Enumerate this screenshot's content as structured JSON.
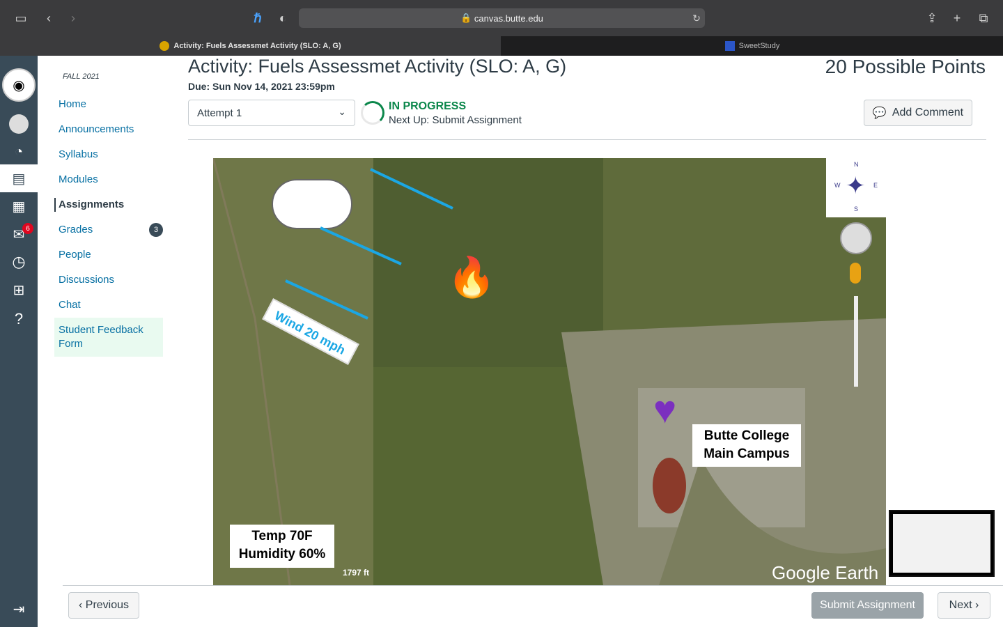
{
  "browser": {
    "url": "canvas.butte.edu",
    "tab_active": "Activity: Fuels Assessmet Activity (SLO: A, G)",
    "tab_other": "SweetStudy"
  },
  "course_nav": {
    "term": "FALL 2021",
    "items": [
      "Home",
      "Announcements",
      "Syllabus",
      "Modules",
      "Assignments",
      "Grades",
      "People",
      "Discussions",
      "Chat",
      "Student Feedback Form"
    ],
    "grades_badge": "3"
  },
  "global_nav": {
    "inbox_badge": "6"
  },
  "assignment": {
    "title": "Activity: Fuels Assessmet Activity (SLO: A, G)",
    "due": "Due: Sun Nov 14, 2021 23:59pm",
    "points": "20 Possible Points",
    "attempt": "Attempt 1",
    "status": "IN PROGRESS",
    "next_up": "Next Up: Submit Assignment",
    "add_comment": "Add Comment"
  },
  "map": {
    "wind": "Wind 20 mph",
    "campus_line1": "Butte College",
    "campus_line2": "Main Campus",
    "temp": "Temp 70F",
    "humidity": "Humidity 60%",
    "scale": "1797 ft",
    "brand": "Google Earth",
    "compass": [
      "N",
      "E",
      "S",
      "W"
    ]
  },
  "footer": {
    "previous": "Previous",
    "submit": "Submit Assignment",
    "next": "Next"
  }
}
